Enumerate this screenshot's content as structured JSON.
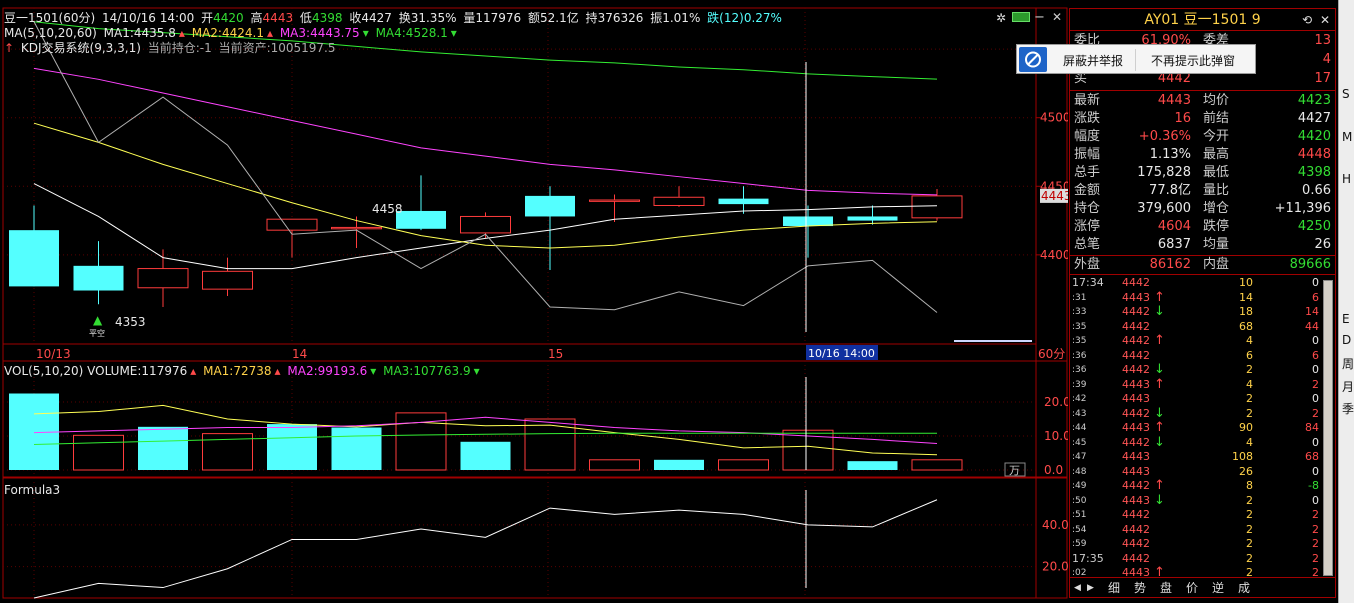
{
  "header": {
    "symbol": "豆一1501",
    "period": "(60分)",
    "datetime": "14/10/16 14:00",
    "open_label": "开",
    "open": "4420",
    "high_label": "高",
    "high": "4443",
    "low_label": "低",
    "low": "4398",
    "close_label": "收",
    "close": "4427",
    "turnover_label": "换",
    "turnover": "31.35%",
    "volume_label": "量",
    "volume": "117976",
    "amount_label": "额",
    "amount": "52.1亿",
    "hold_label": "持",
    "hold": "376326",
    "amplitude_label": "振",
    "amplitude": "1.01%",
    "change_label": "跌(12)",
    "change": "0.27%"
  },
  "ma_line": {
    "label": "MA(5,10,20,60)",
    "ma1": "MA1:4435.8",
    "ma2": "MA2:4424.1",
    "ma3": "MA3:4443.75",
    "ma4": "MA4:4528.1"
  },
  "kdj_line": {
    "system": "KDJ交易系统(9,3,3,1)",
    "position": "当前持仓:-1",
    "assets": "当前资产:1005197.5"
  },
  "volume_header": {
    "label": "VOL(5,10,20)",
    "vol": "VOLUME:117976",
    "ma1": "MA1:72738",
    "ma2": "MA2:99193.6",
    "ma3": "MA3:107763.9"
  },
  "formula": {
    "label": "Formula3"
  },
  "price_axis": {
    "labels": [
      "4550",
      "4500",
      "4450",
      "4400"
    ],
    "current": "4443"
  },
  "vol_axis": {
    "labels": [
      "20.0",
      "10.0",
      "0.0"
    ],
    "unit": "万"
  },
  "formula_axis": {
    "labels": [
      "40.00",
      "20.00"
    ]
  },
  "time_axis": {
    "labels": [
      "10/13",
      "14",
      "15"
    ],
    "crosshair": "10/16 14:00",
    "period": "60分"
  },
  "annotations": {
    "high": "4458",
    "low": "4353",
    "signal": "平空"
  },
  "chart_data": [
    {
      "type": "candlestick",
      "title": "",
      "ylim": [
        4335,
        4580
      ],
      "candles": [
        {
          "open": 4418,
          "close": 4377,
          "high": 4436,
          "low": 4377
        },
        {
          "open": 4392,
          "close": 4374,
          "high": 4410,
          "low": 4364
        },
        {
          "open": 4376,
          "close": 4390,
          "high": 4404,
          "low": 4362
        },
        {
          "open": 4375,
          "close": 4388,
          "high": 4398,
          "low": 4370
        },
        {
          "open": 4418,
          "close": 4426,
          "high": 4426,
          "low": 4398
        },
        {
          "open": 4419,
          "close": 4420,
          "high": 4428,
          "low": 4405
        },
        {
          "open": 4432,
          "close": 4419,
          "high": 4458,
          "low": 4418
        },
        {
          "open": 4416,
          "close": 4428,
          "high": 4431,
          "low": 4412
        },
        {
          "open": 4443,
          "close": 4428,
          "high": 4450,
          "low": 4389
        },
        {
          "open": 4439,
          "close": 4440,
          "high": 4444,
          "low": 4424
        },
        {
          "open": 4436,
          "close": 4442,
          "high": 4450,
          "low": 4435
        },
        {
          "open": 4441,
          "close": 4437,
          "high": 4450,
          "low": 4430
        },
        {
          "open": 4428,
          "close": 4421,
          "high": 4436,
          "low": 4398
        },
        {
          "open": 4428,
          "close": 4425,
          "high": 4436,
          "low": 4422
        },
        {
          "open": 4427,
          "close": 4443,
          "high": 4448,
          "low": 4425
        }
      ],
      "series": [
        {
          "name": "MA1",
          "color": "#ffffff",
          "values": [
            4452,
            4428,
            4398,
            4390,
            4390,
            4398,
            4405,
            4412,
            4418,
            4426,
            4429,
            4432,
            4433,
            4435,
            4435.8
          ]
        },
        {
          "name": "MA2",
          "color": "#ffff55",
          "values": [
            4496,
            4482,
            4466,
            4452,
            4438,
            4425,
            4414,
            4407,
            4405,
            4407,
            4413,
            4418,
            4421,
            4423,
            4424.1
          ]
        },
        {
          "name": "MA3",
          "color": "#ff44ff",
          "values": [
            4536,
            4528,
            4518,
            4508,
            4498,
            4488,
            4478,
            4472,
            4466,
            4462,
            4457,
            4452,
            4447,
            4445,
            4443.75
          ]
        },
        {
          "name": "MA4",
          "color": "#33ee33",
          "values": [
            4570,
            4565,
            4562,
            4559,
            4556,
            4552,
            4548,
            4545,
            4542,
            4540,
            4537,
            4535,
            4532,
            4530,
            4528.1
          ]
        },
        {
          "name": "KDJ",
          "color": "#b0b0b0",
          "values": [
            4570,
            4482,
            4515,
            4480,
            4415,
            4418,
            4390,
            4415,
            4362,
            4360,
            4373,
            4363,
            4392,
            4396,
            4358
          ]
        }
      ]
    },
    {
      "type": "bar",
      "title": "",
      "ylim": [
        0,
        25
      ],
      "values": [
        22.5,
        10.2,
        12.7,
        10.7,
        13.5,
        12.5,
        16.8,
        8.3,
        15.0,
        3.0,
        3.0,
        3.0,
        11.7,
        2.6,
        3.0
      ],
      "bar_colors": [
        "up",
        "down",
        "up",
        "down",
        "up",
        "up",
        "down",
        "up",
        "down",
        "down",
        "up",
        "down",
        "down",
        "up",
        "down"
      ],
      "series": [
        {
          "name": "MA1",
          "color": "#ffff55",
          "values": [
            16.5,
            17.2,
            19.0,
            15.0,
            13.5,
            12.7,
            14.0,
            13.0,
            13.2,
            11.0,
            9.0,
            6.5,
            7.0,
            5.0,
            4.5
          ]
        },
        {
          "name": "MA2",
          "color": "#ff44ff",
          "values": [
            11.0,
            11.5,
            12.0,
            12.5,
            12.5,
            13.0,
            14.0,
            15.5,
            14.0,
            12.5,
            11.5,
            11.0,
            10.0,
            9.0,
            7.8
          ]
        },
        {
          "name": "MA3",
          "color": "#33ee33",
          "values": [
            7.5,
            8.0,
            8.5,
            9.0,
            9.5,
            10.0,
            10.3,
            10.5,
            10.7,
            10.8,
            10.8,
            10.8,
            10.8,
            10.8,
            10.8
          ]
        }
      ]
    },
    {
      "type": "line",
      "title": "",
      "ylim": [
        5,
        60
      ],
      "series": [
        {
          "name": "Formula3",
          "color": "#ffffff",
          "values": [
            5,
            12,
            10,
            19,
            33,
            33,
            38,
            34,
            48,
            45,
            47,
            45,
            40,
            39,
            52
          ]
        }
      ]
    }
  ],
  "quote_panel": {
    "title": "AY01  豆一1501  9",
    "rows_top": [
      {
        "l1": "委比",
        "v1": "61.90%",
        "l2": "委差",
        "v2": "13"
      },
      {
        "l1": "卖",
        "v1": "4443",
        "l2": "",
        "v2": "4"
      },
      {
        "l1": "买",
        "v1": "4442",
        "l2": "",
        "v2": "17"
      }
    ],
    "rows": [
      {
        "l1": "最新",
        "v1": "4443",
        "c1": "red",
        "l2": "均价",
        "v2": "4423",
        "c2": "green"
      },
      {
        "l1": "涨跌",
        "v1": "16",
        "c1": "red",
        "l2": "前结",
        "v2": "4427",
        "c2": "white"
      },
      {
        "l1": "幅度",
        "v1": "+0.36%",
        "c1": "red",
        "l2": "今开",
        "v2": "4420",
        "c2": "green"
      },
      {
        "l1": "振幅",
        "v1": "1.13%",
        "c1": "white",
        "l2": "最高",
        "v2": "4448",
        "c2": "red"
      },
      {
        "l1": "总手",
        "v1": "175,828",
        "c1": "white",
        "l2": "最低",
        "v2": "4398",
        "c2": "green"
      },
      {
        "l1": "金额",
        "v1": "77.8亿",
        "c1": "white",
        "l2": "量比",
        "v2": "0.66",
        "c2": "white"
      },
      {
        "l1": "持仓",
        "v1": "379,600",
        "c1": "white",
        "l2": "增仓",
        "v2": "+11,396",
        "c2": "white"
      },
      {
        "l1": "涨停",
        "v1": "4604",
        "c1": "red",
        "l2": "跌停",
        "v2": "4250",
        "c2": "green"
      },
      {
        "l1": "总笔",
        "v1": "6837",
        "c1": "white",
        "l2": "均量",
        "v2": "26",
        "c2": "white"
      }
    ],
    "outer_label": "外盘",
    "outer": "86162",
    "inner_label": "内盘",
    "inner": "89666",
    "ticks": [
      {
        "t": "17:34",
        "big": true,
        "p": "4442",
        "a": "",
        "ac": "",
        "v": "10",
        "c": "0",
        "cc": "white"
      },
      {
        "t": ":31",
        "big": false,
        "p": "4443",
        "a": "↑",
        "ac": "red",
        "v": "14",
        "c": "6",
        "cc": "red"
      },
      {
        "t": ":33",
        "big": false,
        "p": "4442",
        "a": "↓",
        "ac": "green",
        "v": "18",
        "c": "14",
        "cc": "red"
      },
      {
        "t": ":35",
        "big": false,
        "p": "4442",
        "a": "",
        "ac": "",
        "v": "68",
        "c": "44",
        "cc": "red"
      },
      {
        "t": ":35",
        "big": false,
        "p": "4442",
        "a": "↑",
        "ac": "red",
        "v": "4",
        "c": "0",
        "cc": "white"
      },
      {
        "t": ":36",
        "big": false,
        "p": "4442",
        "a": "",
        "ac": "",
        "v": "6",
        "c": "6",
        "cc": "red"
      },
      {
        "t": ":36",
        "big": false,
        "p": "4442",
        "a": "↓",
        "ac": "green",
        "v": "2",
        "c": "0",
        "cc": "white"
      },
      {
        "t": ":39",
        "big": false,
        "p": "4443",
        "a": "↑",
        "ac": "red",
        "v": "4",
        "c": "2",
        "cc": "red"
      },
      {
        "t": ":42",
        "big": false,
        "p": "4443",
        "a": "",
        "ac": "",
        "v": "2",
        "c": "0",
        "cc": "white"
      },
      {
        "t": ":43",
        "big": false,
        "p": "4442",
        "a": "↓",
        "ac": "green",
        "v": "2",
        "c": "2",
        "cc": "red"
      },
      {
        "t": ":44",
        "big": false,
        "p": "4443",
        "a": "↑",
        "ac": "red",
        "v": "90",
        "c": "84",
        "cc": "red"
      },
      {
        "t": ":45",
        "big": false,
        "p": "4442",
        "a": "↓",
        "ac": "green",
        "v": "4",
        "c": "0",
        "cc": "white"
      },
      {
        "t": ":47",
        "big": false,
        "p": "4443",
        "a": "",
        "ac": "",
        "v": "108",
        "c": "68",
        "cc": "red"
      },
      {
        "t": ":48",
        "big": false,
        "p": "4443",
        "a": "",
        "ac": "",
        "v": "26",
        "c": "0",
        "cc": "white"
      },
      {
        "t": ":49",
        "big": false,
        "p": "4442",
        "a": "↑",
        "ac": "red",
        "v": "8",
        "c": "-8",
        "cc": "green"
      },
      {
        "t": ":50",
        "big": false,
        "p": "4443",
        "a": "↓",
        "ac": "green",
        "v": "2",
        "c": "0",
        "cc": "white"
      },
      {
        "t": ":51",
        "big": false,
        "p": "4442",
        "a": "",
        "ac": "",
        "v": "2",
        "c": "2",
        "cc": "red"
      },
      {
        "t": ":54",
        "big": false,
        "p": "4442",
        "a": "",
        "ac": "",
        "v": "2",
        "c": "2",
        "cc": "red"
      },
      {
        "t": ":59",
        "big": false,
        "p": "4442",
        "a": "",
        "ac": "",
        "v": "2",
        "c": "2",
        "cc": "red"
      },
      {
        "t": "17:35",
        "big": true,
        "p": "4442",
        "a": "",
        "ac": "",
        "v": "2",
        "c": "2",
        "cc": "red"
      },
      {
        "t": ":02",
        "big": false,
        "p": "4443",
        "a": "↑",
        "ac": "red",
        "v": "2",
        "c": "2",
        "cc": "red"
      }
    ],
    "tabs": [
      "细",
      "势",
      "盘",
      "价",
      "逆",
      "成"
    ]
  },
  "popup": {
    "report": "屏蔽并举报",
    "no_remind": "不再提示此弹窗"
  },
  "side_letters": [
    "S",
    "M",
    "H",
    "E",
    "D",
    "周",
    "月",
    "季"
  ],
  "colors": {
    "up": "#ff3c3c",
    "down": "#54ffff",
    "frame": "#a00000",
    "axis_text": "#ff4a4a"
  }
}
